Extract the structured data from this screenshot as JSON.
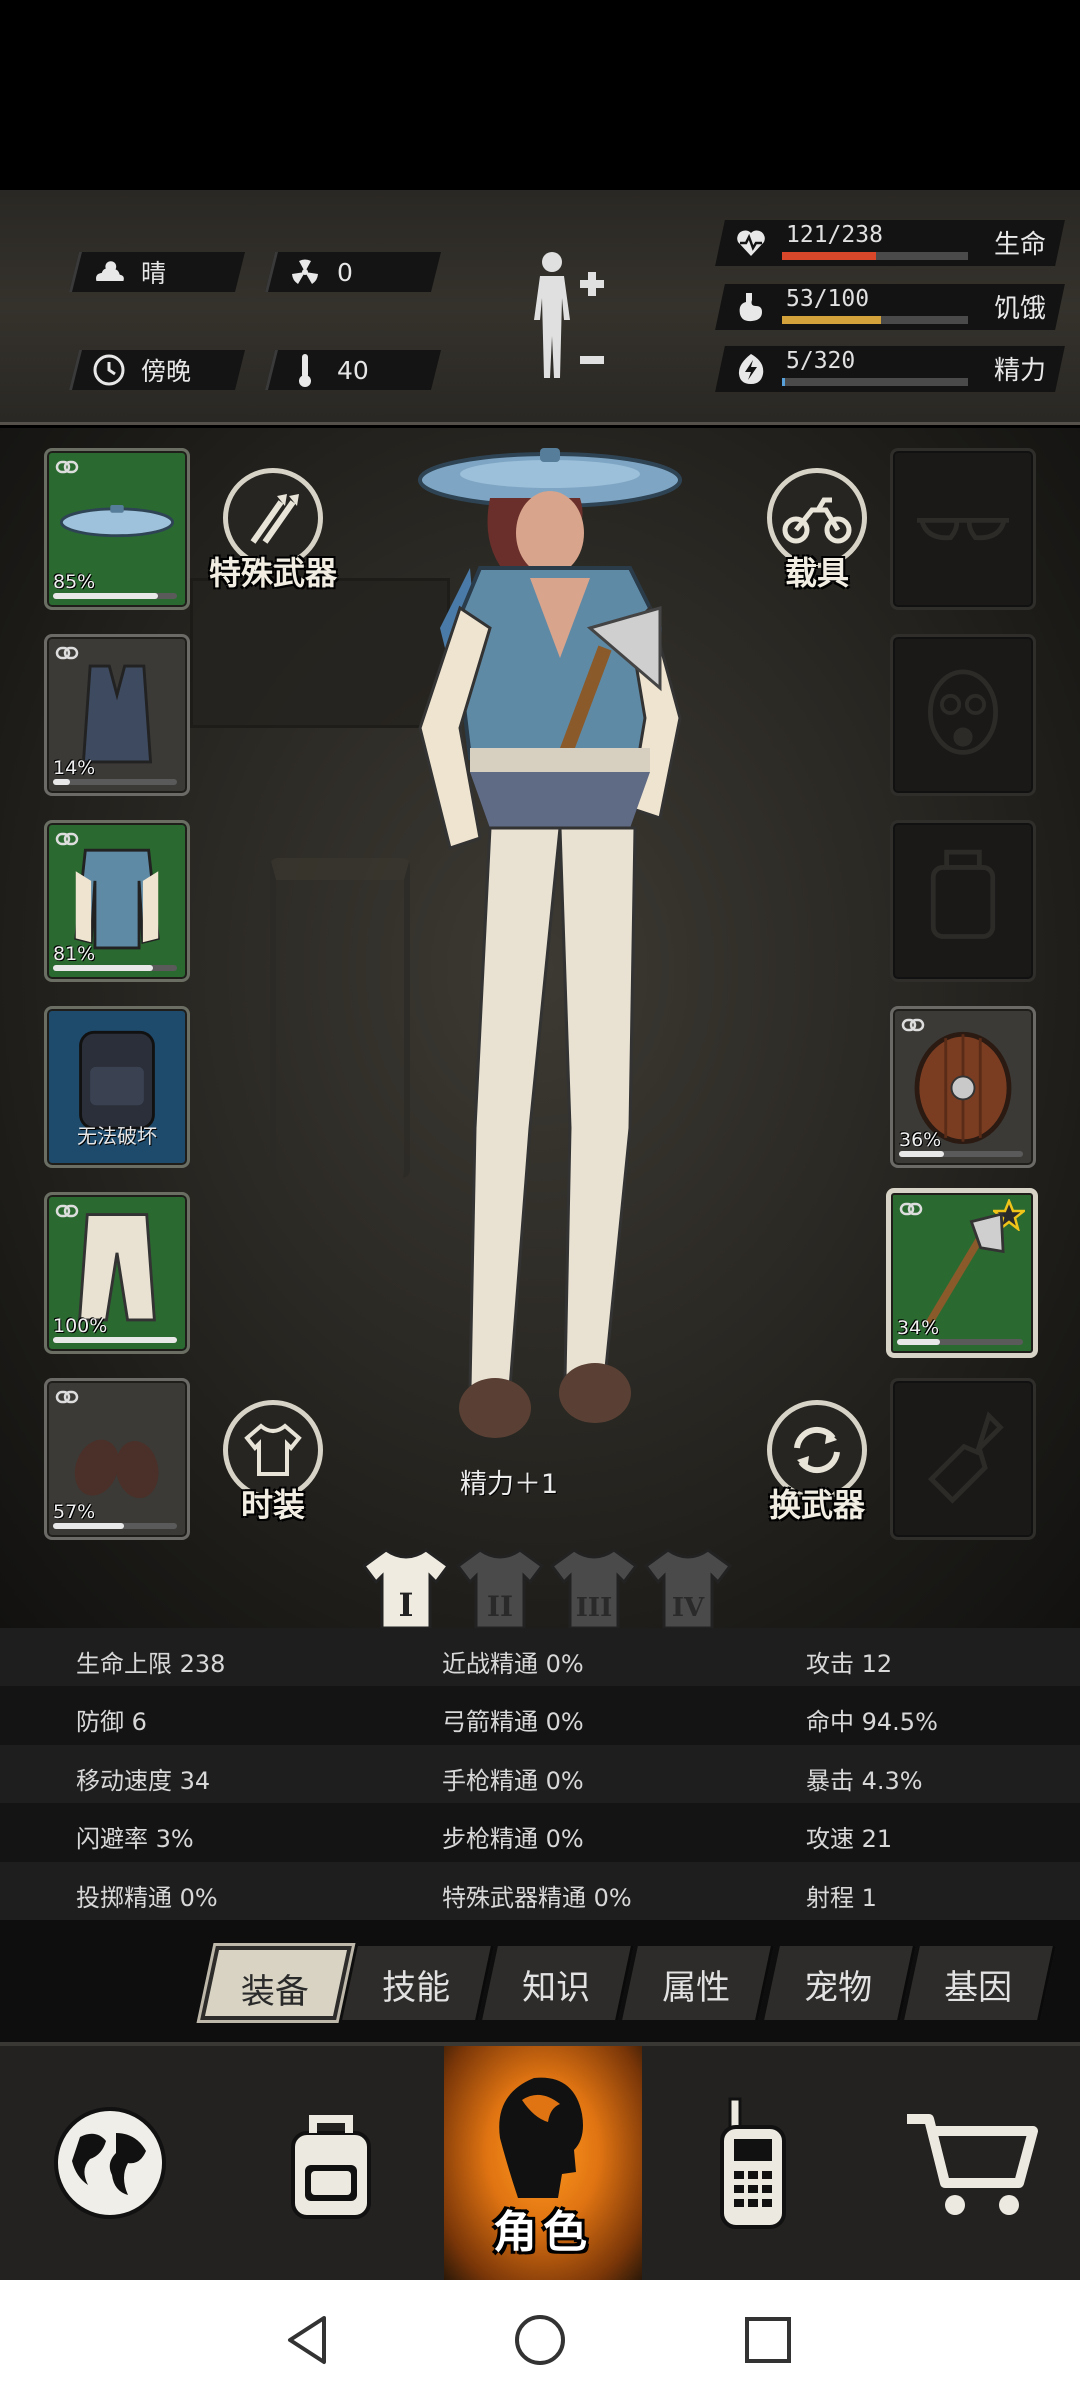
{
  "environment": {
    "weather": "晴",
    "radiation": "0",
    "time_of_day": "傍晚",
    "temperature": "40"
  },
  "vitals": [
    {
      "name": "生命",
      "value": "121/238",
      "fill": 0.508,
      "color": "#d9472b",
      "icon": "heart-icon"
    },
    {
      "name": "饥饿",
      "value": "53/100",
      "fill": 0.53,
      "color": "#d3a23a",
      "icon": "stomach-icon"
    },
    {
      "name": "精力",
      "value": "5/320",
      "fill": 0.016,
      "color": "#5aa0d8",
      "icon": "energy-icon"
    }
  ],
  "equipment_left": [
    {
      "item": "pot-lid-hat",
      "durability": "85%",
      "fill": 0.85
    },
    {
      "item": "vest",
      "durability": "14%",
      "fill": 0.14
    },
    {
      "item": "varsity-jacket",
      "durability": "81%",
      "fill": 0.81
    },
    {
      "item": "backpack",
      "note": "无法破坏"
    },
    {
      "item": "pants",
      "durability": "100%",
      "fill": 1.0
    },
    {
      "item": "shoes",
      "durability": "57%",
      "fill": 0.57
    }
  ],
  "equipment_right": [
    {
      "item": "glasses",
      "empty": true
    },
    {
      "item": "gas-mask",
      "empty": true
    },
    {
      "item": "accessory",
      "empty": true
    },
    {
      "item": "round-shield",
      "durability": "36%",
      "fill": 0.36
    },
    {
      "item": "axe",
      "durability": "34%",
      "fill": 0.34,
      "starred": true
    },
    {
      "item": "throwable",
      "empty": true
    }
  ],
  "buttons": {
    "special_weapon": "特殊武器",
    "vehicle": "载具",
    "fashion": "时装",
    "swap_weapon": "换武器"
  },
  "bonus_text": "精力＋1",
  "outfit_tabs": [
    "I",
    "II",
    "III",
    "IV"
  ],
  "attributes": [
    [
      "生命上限 238",
      "近战精通 0%",
      "攻击 12"
    ],
    [
      "防御 6",
      "弓箭精通 0%",
      "命中 94.5%"
    ],
    [
      "移动速度 34",
      "手枪精通 0%",
      "暴击 4.3%"
    ],
    [
      "闪避率 3%",
      "步枪精通 0%",
      "攻速 21"
    ],
    [
      "投掷精通 0%",
      "特殊武器精通 0%",
      "射程 1"
    ]
  ],
  "tabs": [
    "装备",
    "技能",
    "知识",
    "属性",
    "宠物",
    "基因"
  ],
  "active_tab": "装备",
  "nav": {
    "active_label": "角色",
    "items": [
      "globe-icon",
      "backpack-icon",
      "character-icon",
      "radio-icon",
      "cart-icon"
    ]
  }
}
